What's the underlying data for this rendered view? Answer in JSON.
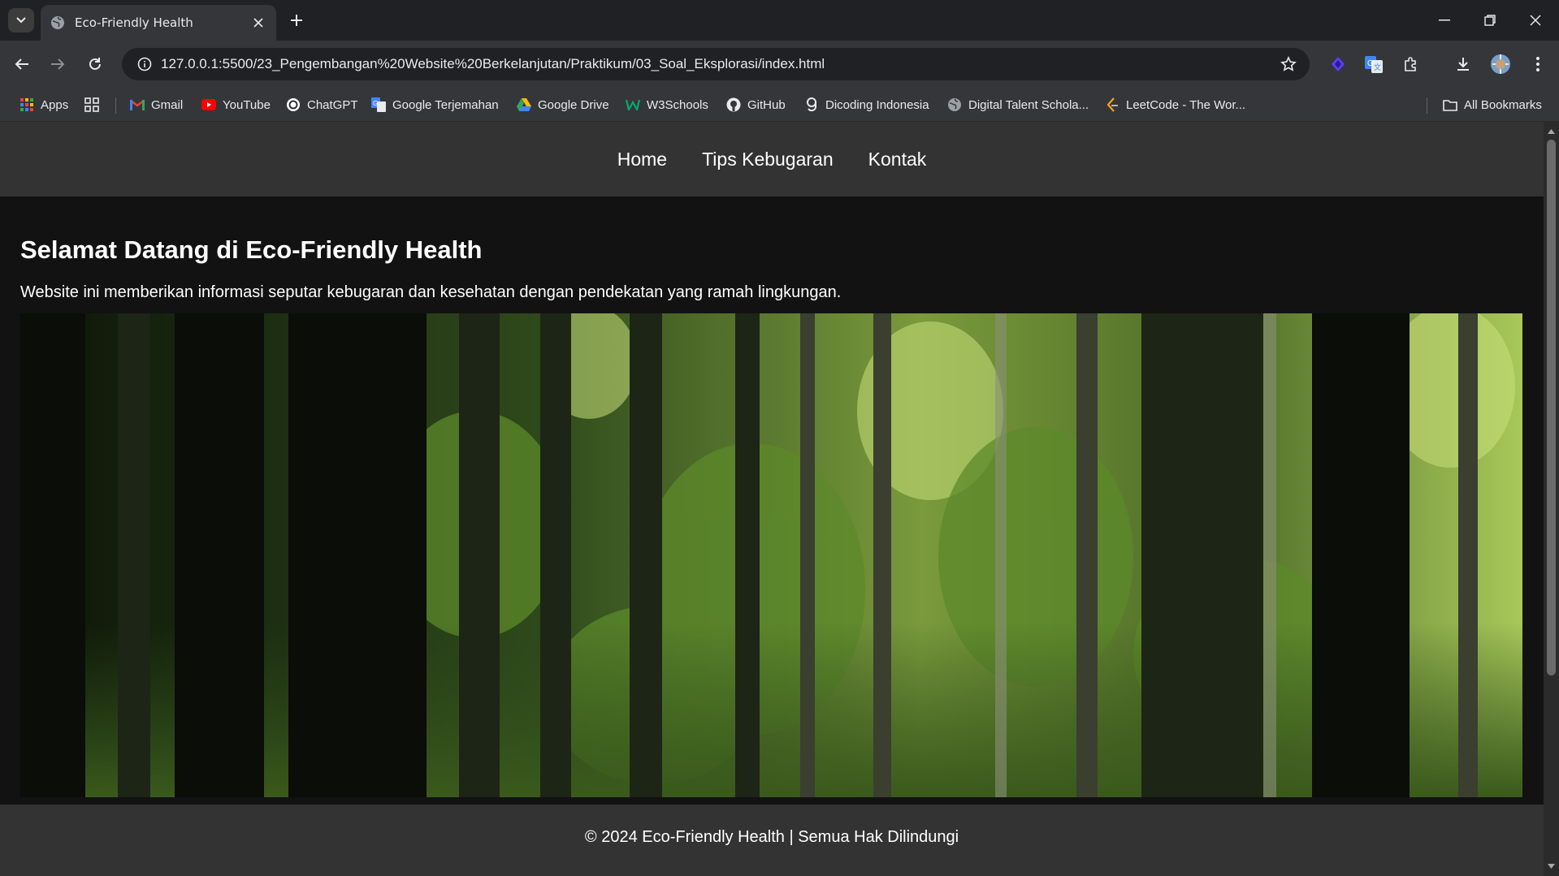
{
  "browser": {
    "tab_title": "Eco-Friendly Health",
    "url": "127.0.0.1:5500/23_Pengembangan%20Website%20Berkelanjutan/Praktikum/03_Soal_Eksplorasi/index.html",
    "bookmarks": [
      {
        "label": "Apps",
        "icon": "apps-grid-icon"
      },
      {
        "label": "Gmail",
        "icon": "gmail-icon"
      },
      {
        "label": "YouTube",
        "icon": "youtube-icon"
      },
      {
        "label": "ChatGPT",
        "icon": "chatgpt-icon"
      },
      {
        "label": "Google Terjemahan",
        "icon": "google-translate-icon"
      },
      {
        "label": "Google Drive",
        "icon": "google-drive-icon"
      },
      {
        "label": "W3Schools",
        "icon": "w3schools-icon"
      },
      {
        "label": "GitHub",
        "icon": "github-icon"
      },
      {
        "label": "Dicoding Indonesia",
        "icon": "dicoding-icon"
      },
      {
        "label": "Digital Talent Schola...",
        "icon": "globe-icon"
      },
      {
        "label": "LeetCode - The Wor...",
        "icon": "leetcode-icon"
      }
    ],
    "all_bookmarks_label": "All Bookmarks"
  },
  "site": {
    "nav": [
      "Home",
      "Tips Kebugaran",
      "Kontak"
    ],
    "heading": "Selamat Datang di Eco-Friendly Health",
    "intro": "Website ini memberikan informasi seputar kebugaran dan kesehatan dengan pendekatan yang ramah lingkungan.",
    "hero_image": "forest-image",
    "footer": "© 2024 Eco-Friendly Health | Semua Hak Dilindungi"
  },
  "colors": {
    "page_bg": "#121212",
    "nav_bg": "#333333",
    "chrome_bg": "#35363a",
    "tabstrip_bg": "#202124"
  }
}
